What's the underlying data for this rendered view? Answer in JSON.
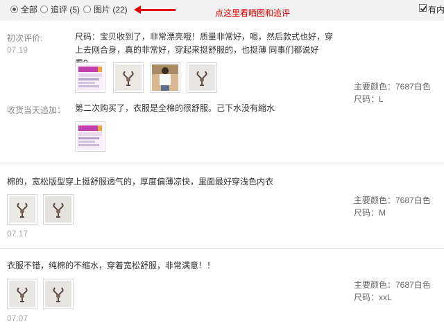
{
  "filter": {
    "options": [
      {
        "label": "全部",
        "selected": true
      },
      {
        "label": "追评 (5)",
        "selected": false
      },
      {
        "label": "图片 (22)",
        "selected": false
      }
    ],
    "hint": "点这里看晒图和追评",
    "checkbox_label": "有内",
    "checkbox_checked": true,
    "hint_color": "#e00000"
  },
  "reviews": [
    {
      "initial_label": "初次评价:",
      "date": "07.19",
      "text": "尺码：宝贝收到了，非常漂亮哦！质量非常好，嗯，然后款式也好，穿上去刚合身，真的非常好，穿起来挺舒服的，也挺薄 同事们都说好看?。",
      "images": [
        "product-screenshot",
        "deer-print",
        "model-photo",
        "deer-print"
      ],
      "followup_label": "收货当天追加：",
      "followup_text": "第二次购买了，衣服是全棉的很舒服。己下水没有缩水",
      "followup_images": [
        "product-screenshot"
      ],
      "color": "主要颜色：7687白色",
      "size": "尺码：L"
    },
    {
      "text": "棉的，宽松版型穿上挺舒服透气的，厚度偏薄凉快，里面最好穿浅色内衣",
      "images": [
        "deer-print",
        "deer-print"
      ],
      "date": "07.17",
      "color": "主要颜色：7687白色",
      "size": "尺码：M"
    },
    {
      "text": "衣服不错，纯棉的不缩水，穿着宽松舒服，非常满意！！",
      "images": [
        "deer-print",
        "deer-print"
      ],
      "date": "07.07",
      "color": "主要颜色：7687白色",
      "size": "尺码：xxL"
    }
  ]
}
